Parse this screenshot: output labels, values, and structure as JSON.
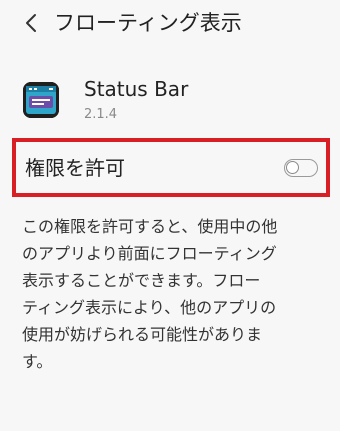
{
  "header": {
    "title": "フローティング表示",
    "back_icon": "chevron-left-icon"
  },
  "app": {
    "name": "Status Bar",
    "version": "2.1.4",
    "icon": "status-bar-app-icon"
  },
  "permission": {
    "label": "権限を許可",
    "enabled": false,
    "highlight_color": "#d91f26"
  },
  "description": {
    "lines": [
      "この権限を許可すると、使用中の他",
      "のアプリより前面にフローティング",
      "表示することができます。フロー",
      "ティング表示により、他のアプリの",
      "使用が妨げられる可能性がありま",
      "す。"
    ]
  }
}
